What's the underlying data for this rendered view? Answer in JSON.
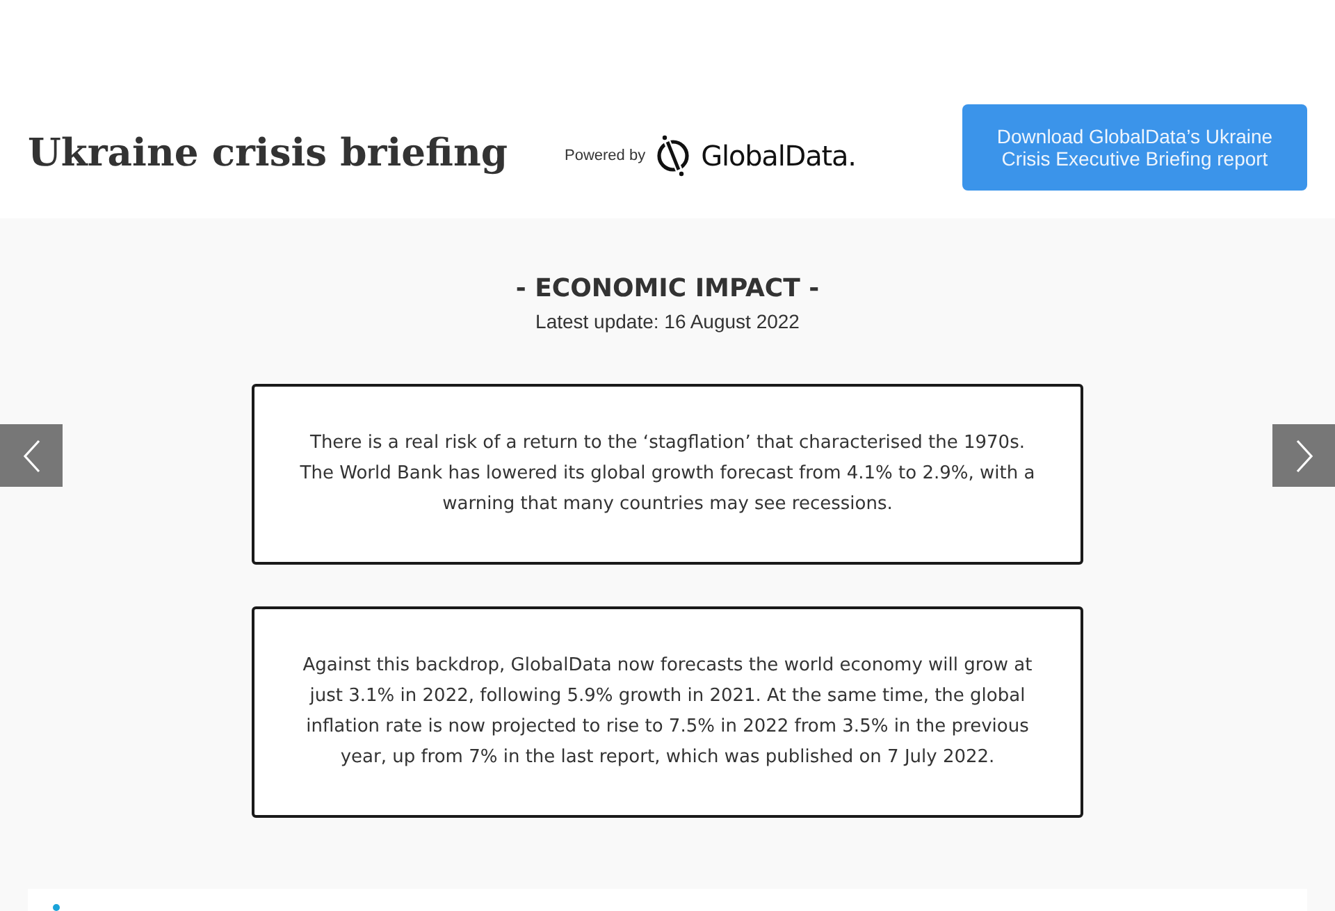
{
  "header": {
    "title": "Ukraine crisis briefing",
    "powered_by": "Powered by",
    "logo_text": "GlobalData.",
    "download_button": "Download GlobalData’s Ukraine Crisis Executive Briefing report"
  },
  "section": {
    "heading": "- ECONOMIC IMPACT -",
    "update": "Latest update: 16 August 2022"
  },
  "slides": [
    "There is a real risk of a return to the ‘stagflation’ that characterised the 1970s. The World Bank has lowered its global growth forecast from 4.1% to 2.9%, with a warning that many countries may see recessions.",
    "Against this backdrop, GlobalData now forecasts the world economy will grow at just 3.1% in 2022, following 5.9% growth in 2021. At the same time, the global inflation rate is now projected to rise to 7.5% in 2022 from 3.5% in the previous year, up from 7% in the last report, which was published on 7 July 2022."
  ]
}
